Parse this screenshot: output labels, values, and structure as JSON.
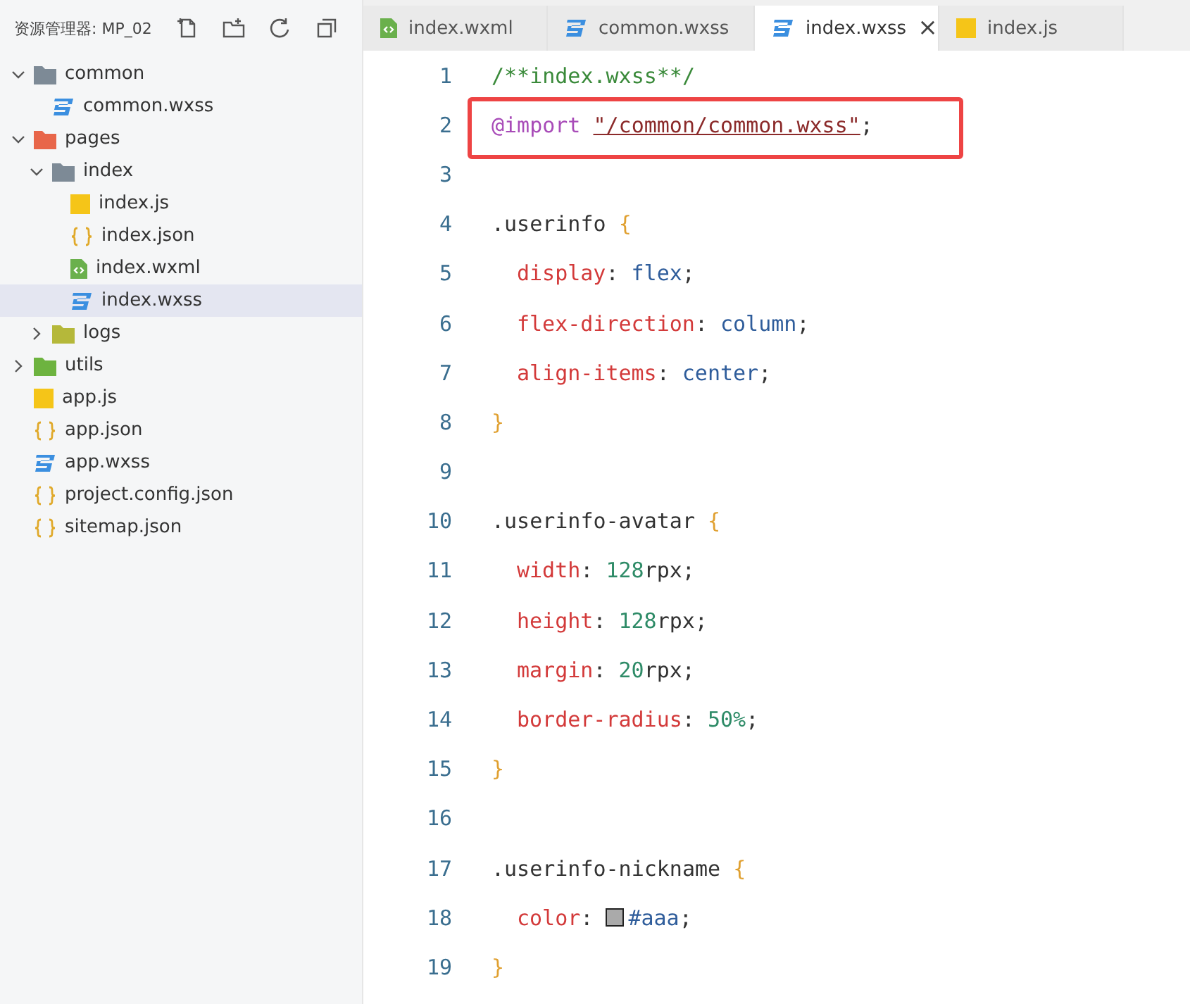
{
  "explorer": {
    "title": "资源管理器: MP_02",
    "tree": [
      {
        "name": "common",
        "kind": "folder",
        "color": "#7d8a96",
        "expanded": true,
        "selected": false,
        "children": [
          {
            "name": "common.wxss",
            "kind": "css",
            "selected": false
          }
        ]
      },
      {
        "name": "pages",
        "kind": "folder",
        "color": "#e8664a",
        "expanded": true,
        "selected": false,
        "children": [
          {
            "name": "index",
            "kind": "folder",
            "color": "#7d8a96",
            "expanded": true,
            "selected": false,
            "children": [
              {
                "name": "index.js",
                "kind": "js",
                "selected": false
              },
              {
                "name": "index.json",
                "kind": "json",
                "selected": false
              },
              {
                "name": "index.wxml",
                "kind": "wxml",
                "selected": false
              },
              {
                "name": "index.wxss",
                "kind": "css",
                "selected": true
              }
            ]
          },
          {
            "name": "logs",
            "kind": "folder",
            "color": "#b5b83a",
            "expanded": false,
            "selected": false
          }
        ]
      },
      {
        "name": "utils",
        "kind": "folder",
        "color": "#6db33f",
        "expanded": false,
        "selected": false
      },
      {
        "name": "app.js",
        "kind": "js",
        "selected": false
      },
      {
        "name": "app.json",
        "kind": "json",
        "selected": false
      },
      {
        "name": "app.wxss",
        "kind": "css",
        "selected": false
      },
      {
        "name": "project.config.json",
        "kind": "json",
        "selected": false
      },
      {
        "name": "sitemap.json",
        "kind": "json",
        "selected": false
      }
    ]
  },
  "tabs": [
    {
      "label": "index.wxml",
      "kind": "wxml",
      "selected": false
    },
    {
      "label": "common.wxss",
      "kind": "css",
      "selected": false
    },
    {
      "label": "index.wxss",
      "kind": "css",
      "selected": true,
      "close": "×"
    },
    {
      "label": "index.js",
      "kind": "js",
      "selected": false
    }
  ],
  "editor": {
    "lines": [
      {
        "number": "1",
        "segments": [
          {
            "kind": "text",
            "tokens": [
              {
                "kind": "comment",
                "s": "/**index.wxss**/"
              }
            ]
          }
        ]
      },
      {
        "number": "2",
        "highlighted": true,
        "segments": [
          {
            "kind": "text",
            "tokens": [
              {
                "kind": "at",
                "s": "@import "
              },
              {
                "kind": "string",
                "s": "\"/common/common.wxss\""
              },
              {
                "kind": "plain",
                "s": ";"
              }
            ]
          }
        ]
      },
      {
        "number": "3"
      },
      {
        "number": "4",
        "segments": [
          {
            "kind": "text",
            "tokens": [
              {
                "kind": "plain",
                "s": ".userinfo "
              },
              {
                "kind": "brace",
                "s": "{"
              }
            ]
          }
        ]
      },
      {
        "number": "5",
        "indented": true,
        "segments": [
          {
            "kind": "text",
            "tokens": [
              {
                "kind": "prop",
                "s": "display"
              },
              {
                "kind": "plain",
                "s": ": "
              },
              {
                "kind": "value",
                "s": "flex"
              },
              {
                "kind": "plain",
                "s": ";"
              }
            ]
          }
        ]
      },
      {
        "number": "6",
        "indented": true,
        "segments": [
          {
            "kind": "text",
            "tokens": [
              {
                "kind": "prop",
                "s": "flex-direction"
              },
              {
                "kind": "plain",
                "s": ": "
              },
              {
                "kind": "value",
                "s": "column"
              },
              {
                "kind": "plain",
                "s": ";"
              }
            ]
          }
        ]
      },
      {
        "number": "7",
        "indented": true,
        "segments": [
          {
            "kind": "text",
            "tokens": [
              {
                "kind": "prop",
                "s": "align-items"
              },
              {
                "kind": "plain",
                "s": ": "
              },
              {
                "kind": "value",
                "s": "center"
              },
              {
                "kind": "plain",
                "s": ";"
              }
            ]
          }
        ]
      },
      {
        "number": "8",
        "segments": [
          {
            "kind": "text",
            "tokens": [
              {
                "kind": "brace",
                "s": "}"
              }
            ]
          }
        ]
      },
      {
        "number": "9"
      },
      {
        "number": "10",
        "segments": [
          {
            "kind": "text",
            "tokens": [
              {
                "kind": "plain",
                "s": ".userinfo-avatar "
              },
              {
                "kind": "brace",
                "s": "{"
              }
            ]
          }
        ]
      },
      {
        "number": "11",
        "indented": true,
        "segments": [
          {
            "kind": "text",
            "tokens": [
              {
                "kind": "prop",
                "s": "width"
              },
              {
                "kind": "plain",
                "s": ": "
              },
              {
                "kind": "number",
                "s": "128"
              },
              {
                "kind": "plain",
                "s": "rpx;"
              }
            ]
          }
        ]
      },
      {
        "number": "12",
        "indented": true,
        "segments": [
          {
            "kind": "text",
            "tokens": [
              {
                "kind": "prop",
                "s": "height"
              },
              {
                "kind": "plain",
                "s": ": "
              },
              {
                "kind": "number",
                "s": "128"
              },
              {
                "kind": "plain",
                "s": "rpx;"
              }
            ]
          }
        ]
      },
      {
        "number": "13",
        "indented": true,
        "segments": [
          {
            "kind": "text",
            "tokens": [
              {
                "kind": "prop",
                "s": "margin"
              },
              {
                "kind": "plain",
                "s": ": "
              },
              {
                "kind": "number",
                "s": "20"
              },
              {
                "kind": "plain",
                "s": "rpx;"
              }
            ]
          }
        ]
      },
      {
        "number": "14",
        "indented": true,
        "segments": [
          {
            "kind": "text",
            "tokens": [
              {
                "kind": "prop",
                "s": "border-radius"
              },
              {
                "kind": "plain",
                "s": ": "
              },
              {
                "kind": "number",
                "s": "50%"
              },
              {
                "kind": "plain",
                "s": ";"
              }
            ]
          }
        ]
      },
      {
        "number": "15",
        "segments": [
          {
            "kind": "text",
            "tokens": [
              {
                "kind": "brace",
                "s": "}"
              }
            ]
          }
        ]
      },
      {
        "number": "16"
      },
      {
        "number": "17",
        "segments": [
          {
            "kind": "text",
            "tokens": [
              {
                "kind": "plain",
                "s": ".userinfo-nickname "
              },
              {
                "kind": "brace",
                "s": "{"
              }
            ]
          }
        ]
      },
      {
        "number": "18",
        "indented": true,
        "segments": [
          {
            "kind": "text",
            "tokens": [
              {
                "kind": "prop",
                "s": "color"
              },
              {
                "kind": "plain",
                "s": ": "
              }
            ]
          },
          {
            "kind": "swatch",
            "color": "#aaaaaa"
          },
          {
            "kind": "text",
            "tokens": [
              {
                "kind": "value",
                "s": "#aaa"
              },
              {
                "kind": "plain",
                "s": ";"
              }
            ]
          }
        ]
      },
      {
        "number": "19",
        "segments": [
          {
            "kind": "text",
            "tokens": [
              {
                "kind": "brace",
                "s": "}"
              }
            ]
          }
        ]
      }
    ]
  }
}
